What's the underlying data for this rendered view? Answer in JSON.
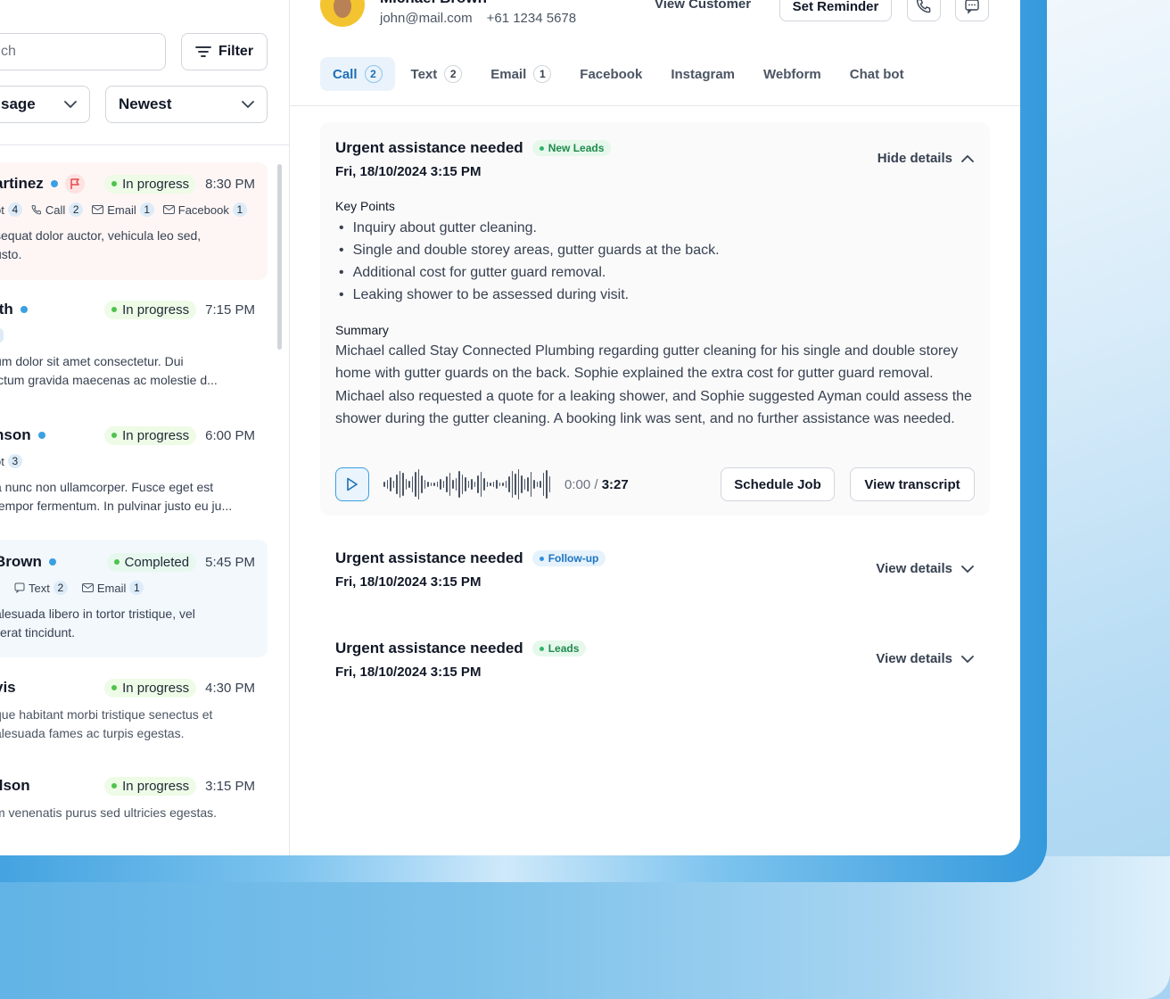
{
  "left": {
    "search_placeholder": "ch",
    "filter_label": "Filter",
    "select_type": "sage",
    "select_sort": "Newest",
    "conversations": [
      {
        "name": "artinez",
        "status": "In progress",
        "time": "8:30 PM",
        "chips": [
          {
            "label": "ot",
            "count": "4"
          },
          {
            "label": "Call",
            "count": "2"
          },
          {
            "label": "Email",
            "count": "1"
          },
          {
            "label": "Facebook",
            "count": "1"
          }
        ],
        "preview1": "sequat dolor auctor, vehicula leo sed,",
        "preview2": "usto."
      },
      {
        "name": "ith",
        "status": "In progress",
        "time": "7:15 PM",
        "preview1": "um dolor sit amet consectetur. Dui",
        "preview2": "ictum gravida maecenas ac molestie d..."
      },
      {
        "name": "nson",
        "status": "In progress",
        "time": "6:00 PM",
        "chips": [
          {
            "label": "ot",
            "count": "3"
          }
        ],
        "preview1": "a nunc non ullamcorper. Fusce eget est",
        "preview2": "tempor fermentum. In pulvinar justo eu ju..."
      },
      {
        "name": "Brown",
        "status": "Completed",
        "time": "5:45 PM",
        "chips": [
          {
            "label": "Text",
            "count": "2"
          },
          {
            "label": "Email",
            "count": "1"
          }
        ],
        "preview1": "alesuada libero in tortor tristique, vel",
        "preview2": "erat tincidunt."
      },
      {
        "name": "vis",
        "status": "In progress",
        "time": "4:30 PM",
        "preview1": "que habitant morbi tristique senectus et",
        "preview2": "alesuada fames ac turpis egestas."
      },
      {
        "name": "ilson",
        "status": "In progress",
        "time": "3:15 PM",
        "preview1": "m venenatis purus sed ultricies egestas."
      }
    ]
  },
  "header": {
    "customer_name": "Michael Brown",
    "email": "john@mail.com",
    "phone": "+61 1234 5678",
    "view_customer": "View Customer",
    "set_reminder": "Set Reminder"
  },
  "tabs": [
    {
      "label": "Call",
      "count": "2"
    },
    {
      "label": "Text",
      "count": "2"
    },
    {
      "label": "Email",
      "count": "1"
    },
    {
      "label": "Facebook"
    },
    {
      "label": "Instagram"
    },
    {
      "label": "Webform"
    },
    {
      "label": "Chat bot"
    }
  ],
  "cards": [
    {
      "title": "Urgent assistance needed",
      "tag": "New Leads",
      "date": "Fri, 18/10/2024 3:15 PM",
      "toggle": "Hide details",
      "key_points_label": "Key Points",
      "key_points": [
        "Inquiry about gutter cleaning.",
        "Single and double storey areas, gutter guards at the back.",
        "Additional cost for gutter guard removal.",
        "Leaking shower to be assessed during visit."
      ],
      "summary_label": "Summary",
      "summary": "Michael called Stay Connected Plumbing regarding gutter cleaning for his single and double storey home with gutter guards on the back. Sophie explained the extra cost for gutter guard removal. Michael also requested a quote for a leaking shower, and Sophie suggested Ayman could assess the shower during the gutter cleaning. A booking link was sent, and no further assistance was needed.",
      "player": {
        "current": "0:00",
        "total": "3:27",
        "progress": 0
      },
      "schedule_job": "Schedule Job",
      "view_transcript": "View transcript"
    },
    {
      "title": "Urgent assistance needed",
      "tag": "Follow-up",
      "date": "Fri, 18/10/2024 3:15 PM",
      "toggle": "View details"
    },
    {
      "title": "Urgent assistance needed",
      "tag": "Leads",
      "date": "Fri, 18/10/2024 3:15 PM",
      "toggle": "View details"
    }
  ],
  "colors": {
    "accent": "#3b9fe3",
    "status_green": "#4ec34e",
    "flag_red": "#e5484d"
  }
}
